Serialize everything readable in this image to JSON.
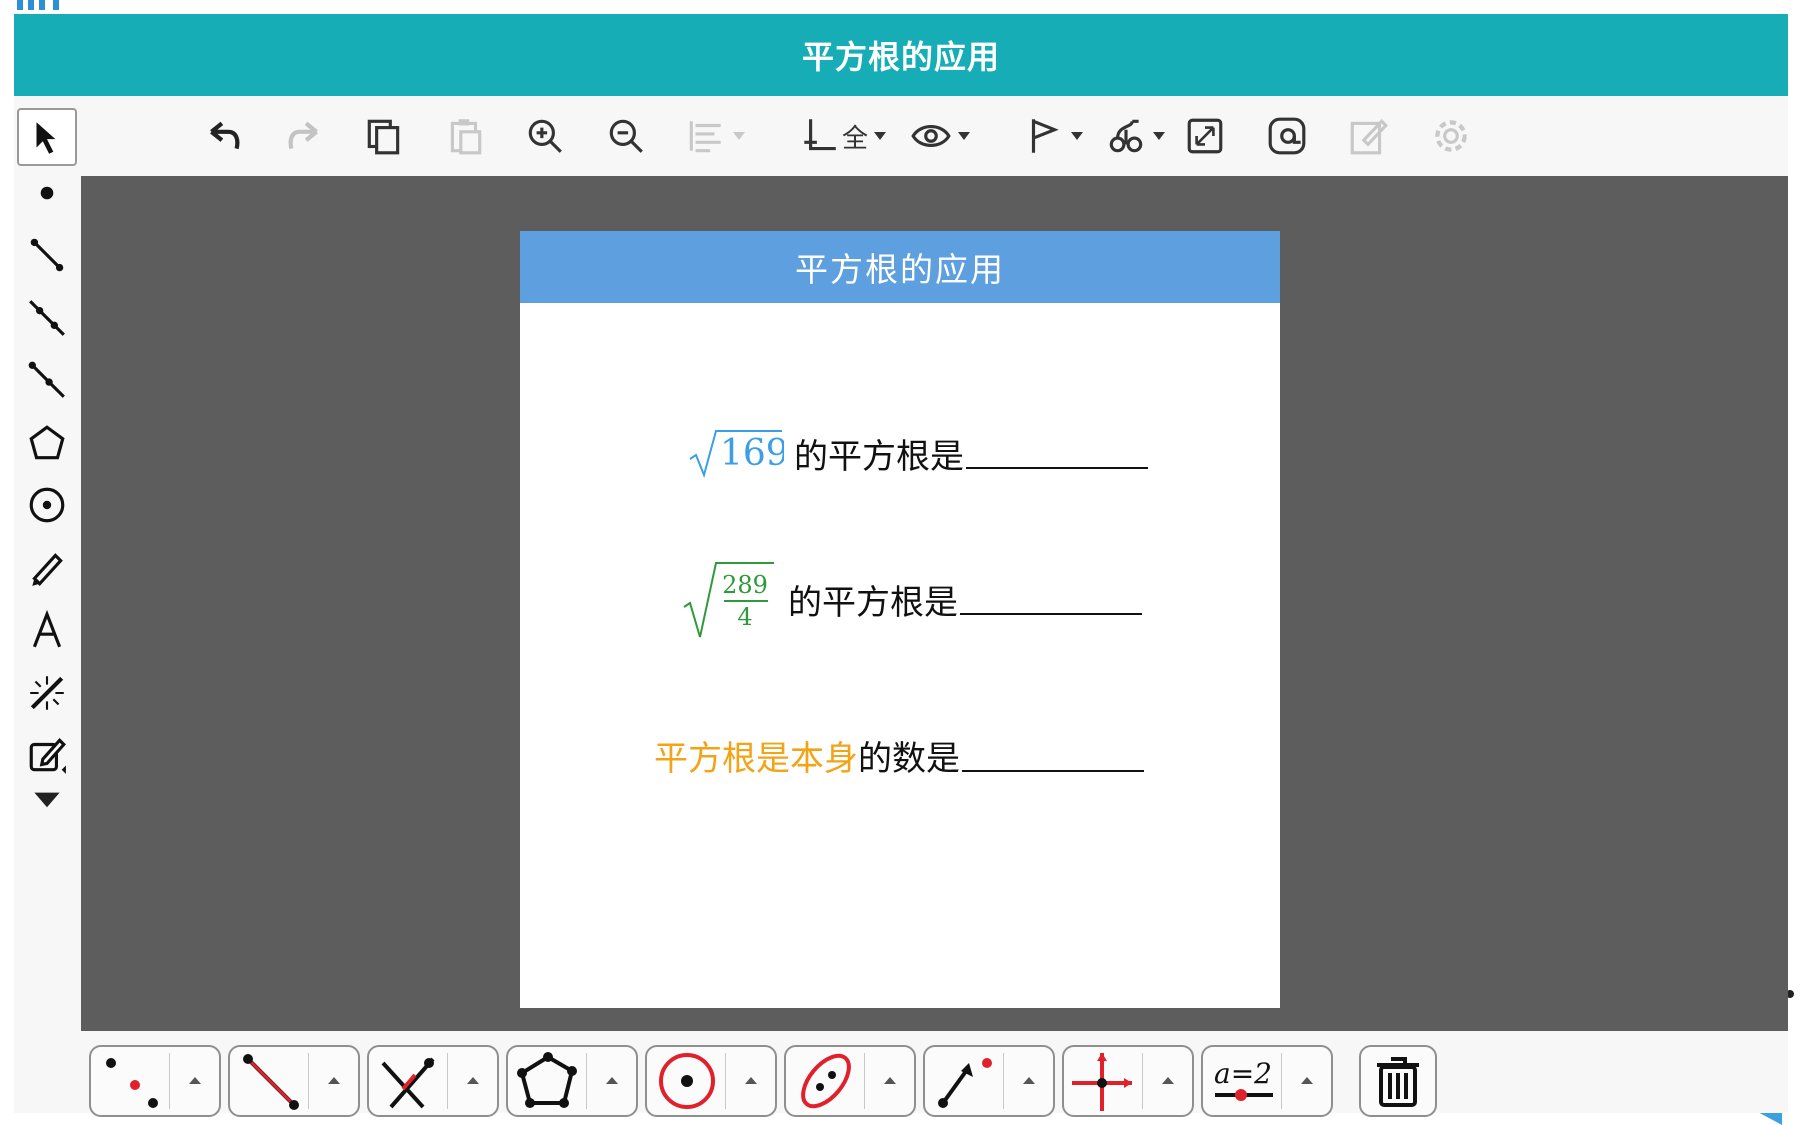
{
  "app": {
    "title": "平方根的应用"
  },
  "panel": {
    "title": "平方根的应用"
  },
  "questions": [
    {
      "radicand": "169",
      "text": "的平方根是"
    },
    {
      "numerator": "289",
      "denominator": "4",
      "text": "的平方根是"
    },
    {
      "highlight": "平方根是本身",
      "text": "的数是"
    }
  ],
  "top_toolbar": {
    "axes_label": "全"
  },
  "bottom_toolbar": {
    "variable_label": "a=2"
  },
  "colors": {
    "title_bar": "#16adb6",
    "panel_header": "#5d9fdf",
    "canvas": "#5d5d5d",
    "q1_math": "#3b9ee6",
    "q2_math": "#2f9a3a",
    "q3_highlight": "#f2a316",
    "tool_red": "#e0202a"
  },
  "icons": {
    "left_toolbar": [
      "move-arrow-icon",
      "point-icon",
      "segment-icon",
      "line-icon",
      "ray-icon",
      "polygon-icon",
      "circle-icon",
      "pen-icon",
      "text-icon",
      "transform-icon",
      "edit-icon",
      "more-tools-icon"
    ],
    "top_toolbar": [
      "undo-icon",
      "redo-icon",
      "copy-icon",
      "paste-icon",
      "zoom-in-icon",
      "zoom-out-icon",
      "align-icon",
      "axes-icon",
      "visibility-icon",
      "flag-icon",
      "trace-icon",
      "fullscreen-icon",
      "at-icon",
      "note-icon",
      "settings-icon"
    ],
    "bottom_toolbar": [
      "points-tool-icon",
      "segment-tool-icon",
      "intersect-tool-icon",
      "polygon-tool-icon",
      "circle-tool-icon",
      "conic-tool-icon",
      "vector-tool-icon",
      "axes-tool-icon",
      "slider-tool-icon",
      "trash-icon"
    ]
  }
}
